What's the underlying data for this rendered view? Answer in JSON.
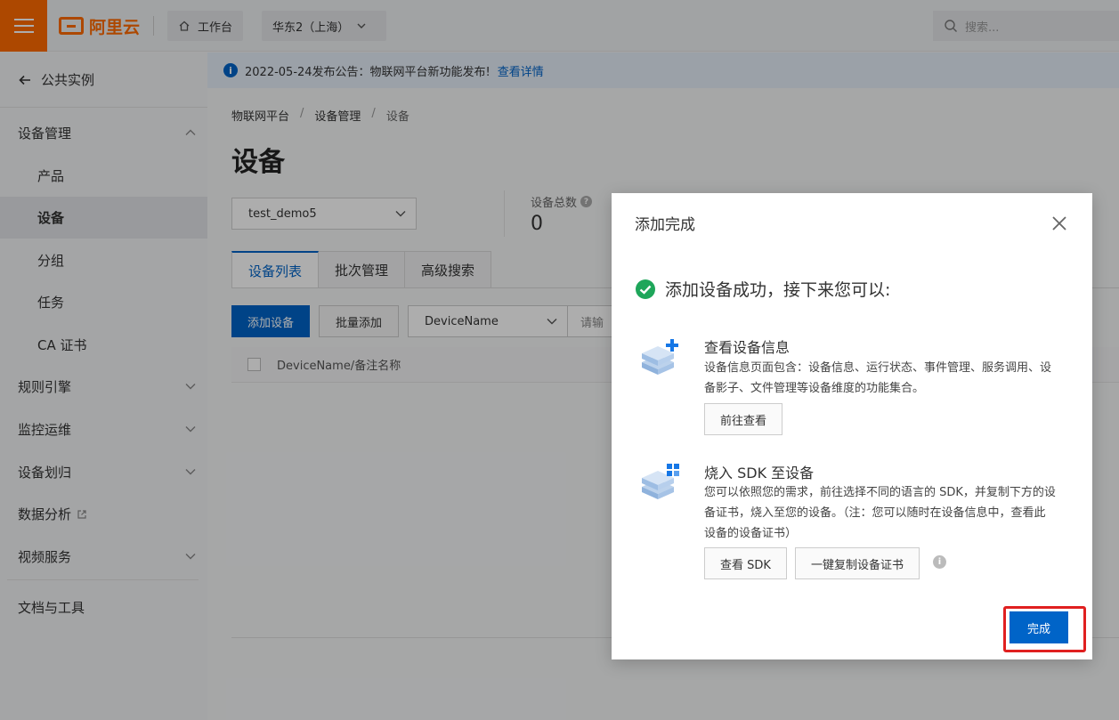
{
  "topbar": {
    "logo_text": "阿里云",
    "workbench_label": "工作台",
    "region_label": "华东2（上海）",
    "search_placeholder": "搜索..."
  },
  "sidebar": {
    "back_label": "公共实例",
    "items": [
      {
        "label": "设备管理"
      },
      {
        "label": "产品"
      },
      {
        "label": "设备"
      },
      {
        "label": "分组"
      },
      {
        "label": "任务"
      },
      {
        "label": "CA 证书"
      },
      {
        "label": "规则引擎"
      },
      {
        "label": "监控运维"
      },
      {
        "label": "设备划归"
      },
      {
        "label": "数据分析"
      },
      {
        "label": "视频服务"
      },
      {
        "label": "文档与工具"
      }
    ]
  },
  "notice": {
    "text": "2022-05-24发布公告：物联网平台新功能发布!",
    "link": "查看详情"
  },
  "breadcrumb": [
    "物联网平台",
    "设备管理",
    "设备"
  ],
  "page": {
    "title": "设备",
    "product_select": "test_demo5",
    "stat_label": "设备总数",
    "stat_value": "0"
  },
  "tabs": [
    "设备列表",
    "批次管理",
    "高级搜索"
  ],
  "toolbar": {
    "add_device": "添加设备",
    "batch_add": "批量添加",
    "filter_field": "DeviceName",
    "filter_input": "请输"
  },
  "table": {
    "col_name": "DeviceName/备注名称"
  },
  "modal": {
    "title": "添加完成",
    "success_text": "添加设备成功，接下来您可以:",
    "section1": {
      "title": "查看设备信息",
      "desc_line1": "设备信息页面包含：设备信息、运行状态、事件管理、服务调用、设",
      "desc_line2": "备影子、文件管理等设备维度的功能集合。",
      "button": "前往查看"
    },
    "section2": {
      "title": "烧入 SDK 至设备",
      "desc_line1": "您可以依照您的需求，前往选择不同的语言的 SDK，并复制下方的设",
      "desc_line2": "备证书，烧入至您的设备。（注：您可以随时在设备信息中，查看此",
      "desc_line3": "设备的设备证书）",
      "button_sdk": "查看 SDK",
      "button_copy": "一键复制设备证书"
    },
    "finish": "完成"
  },
  "colors": {
    "brand": "#ff6a00",
    "primary": "#0064c8",
    "success": "#1ea65a",
    "highlight": "#e02020"
  }
}
